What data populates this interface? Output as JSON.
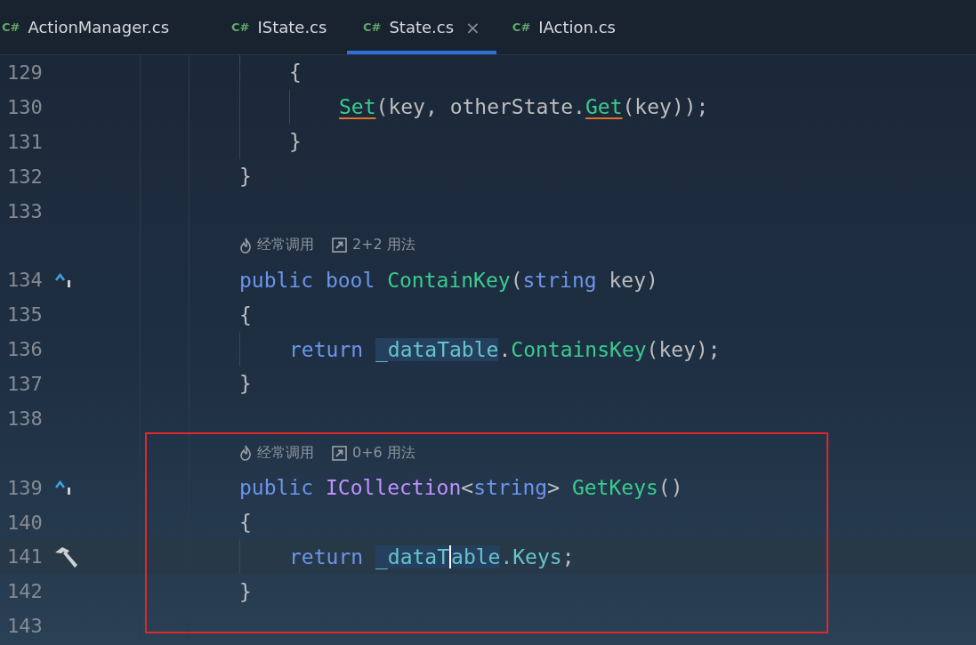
{
  "tabs": [
    {
      "badge": "C#",
      "label": "ActionManager.cs",
      "selected": false
    },
    {
      "badge": "C#",
      "label": "IState.cs",
      "selected": false
    },
    {
      "badge": "C#",
      "label": "State.cs",
      "selected": true,
      "close": "×"
    },
    {
      "badge": "C#",
      "label": "IAction.cs",
      "selected": false
    }
  ],
  "editor": {
    "rows": [
      {
        "kind": "block",
        "children": [
          {
            "kind": "code",
            "line": "129",
            "code": [
              {
                "t": "{",
                "kind": "plain"
              }
            ],
            "children": [
              {
                "kind": "code",
                "line": "130",
                "code": [
                  {
                    "t": "Set",
                    "kind": "method",
                    "warning": true
                  },
                  {
                    "t": "(key, otherState.",
                    "kind": "plain"
                  },
                  {
                    "t": "Get",
                    "kind": "method",
                    "warning": true
                  },
                  {
                    "t": "(key));",
                    "kind": "plain"
                  }
                ]
              }
            ]
          },
          {
            "kind": "code",
            "line": "131",
            "code": [
              {
                "t": "}",
                "kind": "plain"
              }
            ]
          }
        ]
      },
      {
        "kind": "code",
        "line": "132",
        "code": [
          {
            "t": "}",
            "kind": "plain"
          }
        ]
      },
      {
        "kind": "code",
        "line": "133"
      },
      {
        "kind": "hint",
        "heat": "经常调用",
        "usages": "2+2 用法"
      },
      {
        "kind": "code",
        "line": "134",
        "marker": {
          "kind": "override"
        },
        "code": [
          {
            "t": "public bool ",
            "kind": "keyword"
          },
          {
            "t": "ContainKey",
            "kind": "method"
          },
          {
            "t": "(",
            "kind": "plain"
          },
          {
            "t": "string",
            "kind": "keyword"
          },
          {
            "t": " key)",
            "kind": "plain"
          }
        ]
      },
      {
        "kind": "code",
        "line": "135",
        "code": [
          {
            "t": "{",
            "kind": "plain"
          }
        ],
        "children": [
          {
            "kind": "code",
            "line": "136",
            "code": [
              {
                "t": "return ",
                "kind": "keyword"
              },
              {
                "t": "_dataTable",
                "kind": "field",
                "highlighted": true
              },
              {
                "t": ".",
                "kind": "plain"
              },
              {
                "t": "ContainsKey",
                "kind": "method"
              },
              {
                "t": "(key);",
                "kind": "plain"
              }
            ]
          }
        ]
      },
      {
        "kind": "code",
        "line": "137",
        "code": [
          {
            "t": "}",
            "kind": "plain"
          }
        ]
      },
      {
        "kind": "code",
        "line": "138"
      },
      {
        "kind": "hint",
        "heat": "经常调用",
        "usages": "0+6 用法"
      },
      {
        "kind": "code",
        "line": "139",
        "marker": {
          "kind": "override"
        },
        "code": [
          {
            "t": "public ",
            "kind": "keyword"
          },
          {
            "t": "ICollection",
            "kind": "interface"
          },
          {
            "t": "<",
            "kind": "plain"
          },
          {
            "t": "string",
            "kind": "keyword"
          },
          {
            "t": "> ",
            "kind": "plain"
          },
          {
            "t": "GetKeys",
            "kind": "method"
          },
          {
            "t": "()",
            "kind": "plain"
          }
        ]
      },
      {
        "kind": "code",
        "line": "140",
        "code": [
          {
            "t": "{",
            "kind": "plain"
          }
        ],
        "children": [
          {
            "kind": "code",
            "line": "141",
            "marker": {
              "kind": "hammer"
            },
            "current": true,
            "code": [
              {
                "t": "return ",
                "kind": "keyword"
              },
              {
                "t": "_dataT",
                "kind": "field",
                "highlighted": true,
                "caret": true
              },
              {
                "t": "able",
                "kind": "field",
                "highlighted": true
              },
              {
                "t": ".Keys",
                "kind": "field"
              },
              {
                "t": ";",
                "kind": "plain"
              }
            ]
          }
        ]
      },
      {
        "kind": "code",
        "line": "142",
        "code": [
          {
            "t": "}",
            "kind": "plain"
          }
        ]
      },
      {
        "kind": "code",
        "line": "143"
      }
    ]
  }
}
